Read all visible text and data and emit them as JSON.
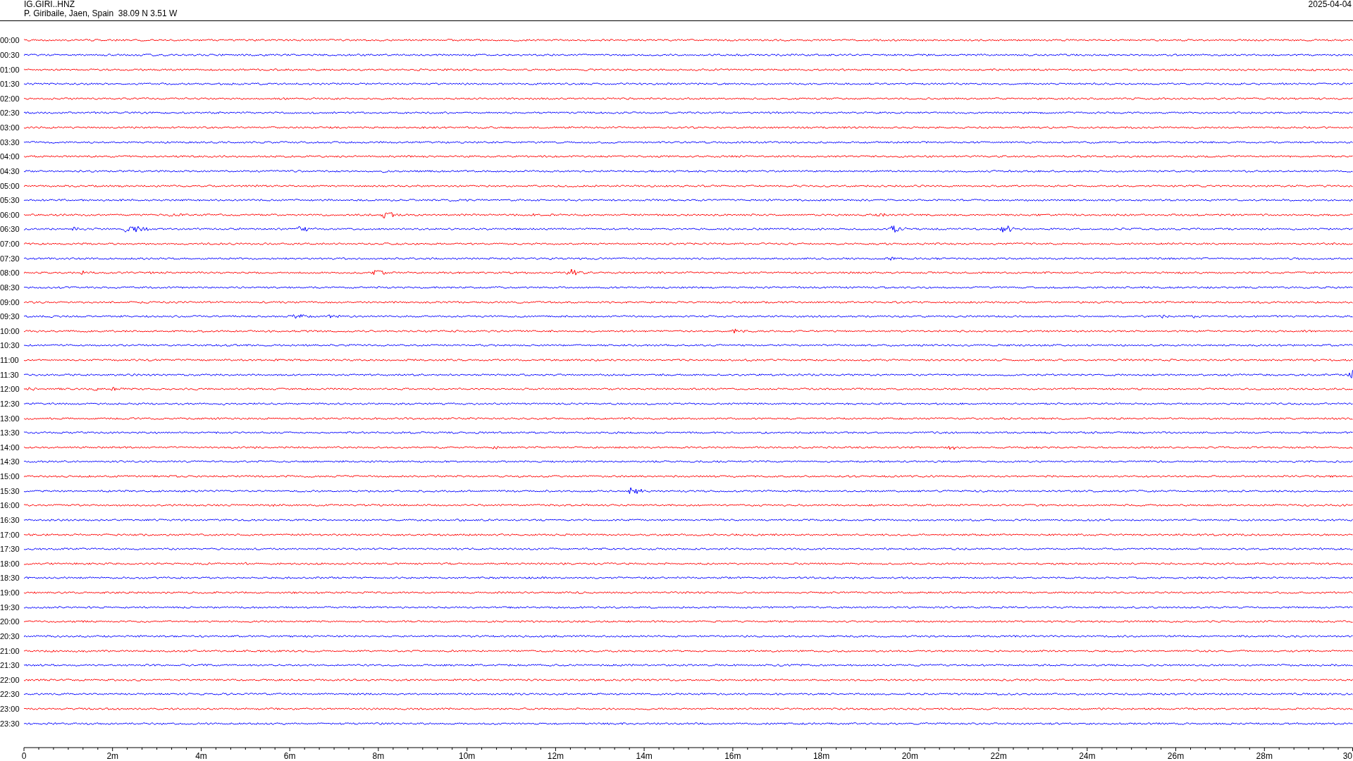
{
  "header": {
    "station": "IG.GIRI..HNZ",
    "location": "P. Giribaile, Jaen, Spain  38.09 N 3.51 W",
    "date": "2025-04-04"
  },
  "rows": [
    {
      "time": "00:00",
      "color": "#ff0000"
    },
    {
      "time": "00:30",
      "color": "#0000ff"
    },
    {
      "time": "01:00",
      "color": "#ff0000"
    },
    {
      "time": "01:30",
      "color": "#0000ff"
    },
    {
      "time": "02:00",
      "color": "#ff0000"
    },
    {
      "time": "02:30",
      "color": "#0000ff"
    },
    {
      "time": "03:00",
      "color": "#ff0000"
    },
    {
      "time": "03:30",
      "color": "#0000ff"
    },
    {
      "time": "04:00",
      "color": "#ff0000"
    },
    {
      "time": "04:30",
      "color": "#0000ff"
    },
    {
      "time": "05:00",
      "color": "#ff0000"
    },
    {
      "time": "05:30",
      "color": "#0000ff"
    },
    {
      "time": "06:00",
      "color": "#ff0000"
    },
    {
      "time": "06:30",
      "color": "#0000ff"
    },
    {
      "time": "07:00",
      "color": "#ff0000"
    },
    {
      "time": "07:30",
      "color": "#0000ff"
    },
    {
      "time": "08:00",
      "color": "#ff0000"
    },
    {
      "time": "08:30",
      "color": "#0000ff"
    },
    {
      "time": "09:00",
      "color": "#ff0000"
    },
    {
      "time": "09:30",
      "color": "#0000ff"
    },
    {
      "time": "10:00",
      "color": "#ff0000"
    },
    {
      "time": "10:30",
      "color": "#0000ff"
    },
    {
      "time": "11:00",
      "color": "#ff0000"
    },
    {
      "time": "11:30",
      "color": "#0000ff"
    },
    {
      "time": "12:00",
      "color": "#ff0000"
    },
    {
      "time": "12:30",
      "color": "#0000ff"
    },
    {
      "time": "13:00",
      "color": "#ff0000"
    },
    {
      "time": "13:30",
      "color": "#0000ff"
    },
    {
      "time": "14:00",
      "color": "#ff0000"
    },
    {
      "time": "14:30",
      "color": "#0000ff"
    },
    {
      "time": "15:00",
      "color": "#ff0000"
    },
    {
      "time": "15:30",
      "color": "#0000ff"
    },
    {
      "time": "16:00",
      "color": "#ff0000"
    },
    {
      "time": "16:30",
      "color": "#0000ff"
    },
    {
      "time": "17:00",
      "color": "#ff0000"
    },
    {
      "time": "17:30",
      "color": "#0000ff"
    },
    {
      "time": "18:00",
      "color": "#ff0000"
    },
    {
      "time": "18:30",
      "color": "#0000ff"
    },
    {
      "time": "19:00",
      "color": "#ff0000"
    },
    {
      "time": "19:30",
      "color": "#0000ff"
    },
    {
      "time": "20:00",
      "color": "#ff0000"
    },
    {
      "time": "20:30",
      "color": "#0000ff"
    },
    {
      "time": "21:00",
      "color": "#ff0000"
    },
    {
      "time": "21:30",
      "color": "#0000ff"
    },
    {
      "time": "22:00",
      "color": "#ff0000"
    },
    {
      "time": "22:30",
      "color": "#0000ff"
    },
    {
      "time": "23:00",
      "color": "#ff0000"
    },
    {
      "time": "23:30",
      "color": "#0000ff"
    }
  ],
  "axis_labels": [
    "0",
    "2m",
    "4m",
    "6m",
    "8m",
    "10m",
    "12m",
    "14m",
    "16m",
    "18m",
    "20m",
    "22m",
    "24m",
    "26m",
    "28m",
    "30"
  ]
}
